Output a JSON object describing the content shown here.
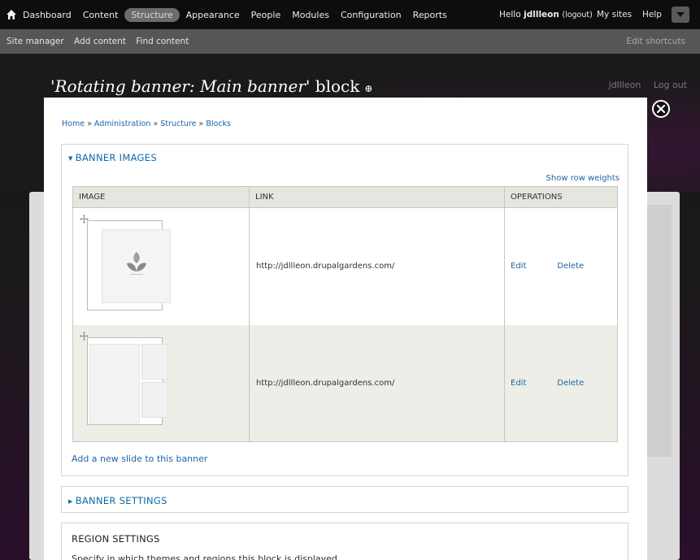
{
  "toolbar": {
    "menu": [
      "Dashboard",
      "Content",
      "Structure",
      "Appearance",
      "People",
      "Modules",
      "Configuration",
      "Reports"
    ],
    "active_item": "Structure",
    "greeting": "Hello",
    "username": "jdllleon",
    "logout": "(logout)",
    "my_sites": "My sites",
    "help": "Help"
  },
  "shortcuts": {
    "links": [
      "Site manager",
      "Add content",
      "Find content"
    ],
    "edit": "Edit shortcuts"
  },
  "background": {
    "title_quoted": "'Rotating banner: Main banner'",
    "title_suffix": "block",
    "user": "jdllleon",
    "logout": "Log out"
  },
  "breadcrumb": [
    "Home",
    "Administration",
    "Structure",
    "Blocks"
  ],
  "banner_images": {
    "legend": "BANNER IMAGES",
    "show_row_weights": "Show row weights",
    "columns": [
      "IMAGE",
      "LINK",
      "OPERATIONS"
    ],
    "rows": [
      {
        "link": "http://jdllleon.drupalgardens.com/",
        "edit": "Edit",
        "delete": "Delete"
      },
      {
        "link": "http://jdllleon.drupalgardens.com/",
        "edit": "Edit",
        "delete": "Delete"
      }
    ],
    "add_slide": "Add a new slide to this banner"
  },
  "banner_settings": {
    "legend": "BANNER SETTINGS"
  },
  "region_settings": {
    "title": "REGION SETTINGS",
    "description": "Specify in which themes and regions this block is displayed."
  }
}
